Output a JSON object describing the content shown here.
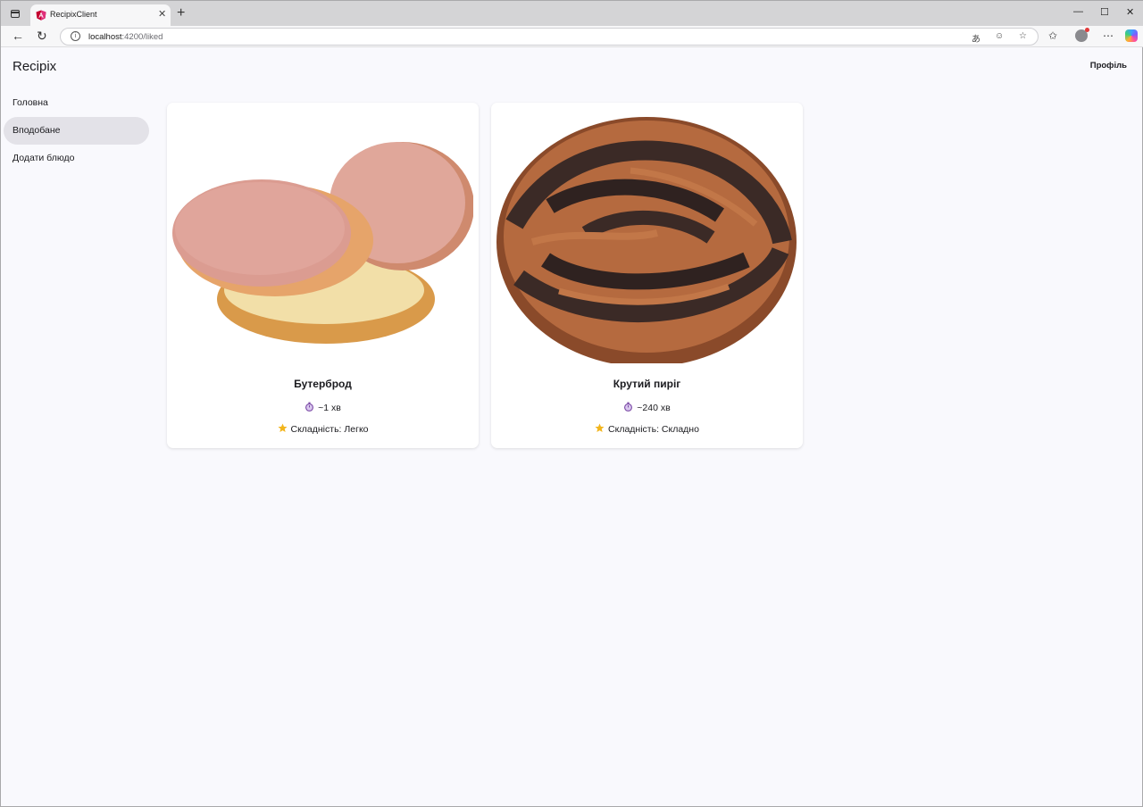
{
  "browser": {
    "tab_title": "RecipixClient",
    "tab_close": "✕",
    "new_tab": "+",
    "url_host": "localhost",
    "url_path": ":4200/liked",
    "window_controls": {
      "minimize": "—",
      "maximize": "☐",
      "close": "✕"
    }
  },
  "app": {
    "brand": "Recipix",
    "profile_label": "Профіль"
  },
  "sidebar": {
    "items": [
      {
        "label": "Головна",
        "active": false
      },
      {
        "label": "Вподобане",
        "active": true
      },
      {
        "label": "Додати блюдо",
        "active": false
      }
    ]
  },
  "recipes": [
    {
      "title": "Бутерброд",
      "time": "~1 хв",
      "difficulty": "Складність: Легко",
      "image": "sandwich-with-sausage-slices"
    },
    {
      "title": "Крутий пиріг",
      "time": "~240 хв",
      "difficulty": "Складність: Складно",
      "image": "braided-poppy-seed-cake"
    }
  ],
  "icons": {
    "timer": "stopwatch-icon",
    "star": "star-icon"
  },
  "colors": {
    "background": "#f9f9fd",
    "active_nav": "#e3e2e8",
    "star": "#f2b51d",
    "timer": "#7b4aa6"
  }
}
